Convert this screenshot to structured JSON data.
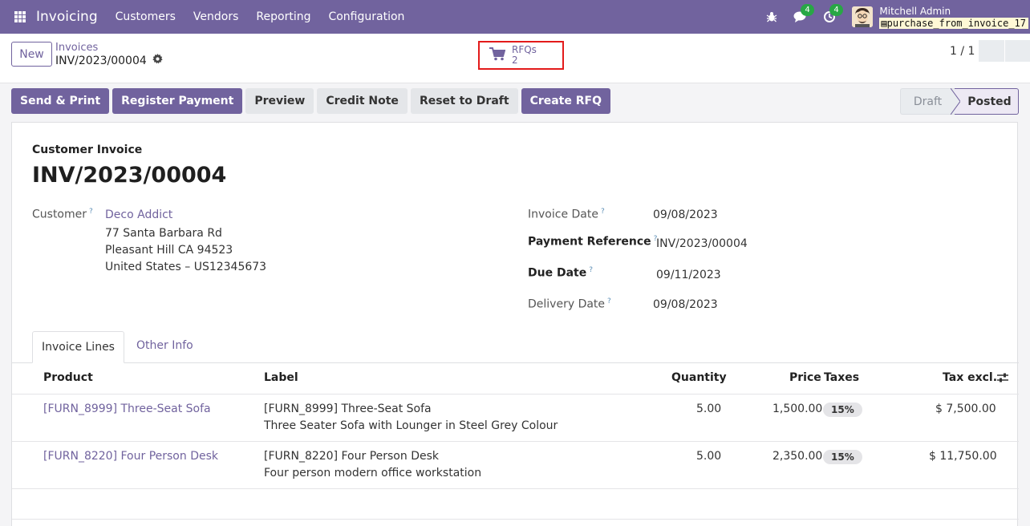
{
  "navbar": {
    "app_name": "Invoicing",
    "menu": [
      "Customers",
      "Vendors",
      "Reporting",
      "Configuration"
    ],
    "messages_count": "4",
    "activities_count": "4",
    "user_name": "Mitchell Admin",
    "db_name": "purchase_from_invoice_17"
  },
  "control": {
    "new_label": "New",
    "breadcrumb_parent": "Invoices",
    "breadcrumb_current": "INV/2023/00004",
    "smart_button": {
      "label": "RFQs",
      "count": "2"
    },
    "pager": "1 / 1"
  },
  "actions": {
    "send_print": "Send & Print",
    "register_payment": "Register Payment",
    "preview": "Preview",
    "credit_note": "Credit Note",
    "reset_to_draft": "Reset to Draft",
    "create_rfq": "Create RFQ"
  },
  "status": {
    "draft": "Draft",
    "posted": "Posted"
  },
  "document": {
    "type": "Customer Invoice",
    "name": "INV/2023/00004",
    "customer_label": "Customer",
    "customer_name": "Deco Addict",
    "address_line1": "77 Santa Barbara Rd",
    "address_line2": "Pleasant Hill CA 94523",
    "address_line3": "United States – US12345673",
    "invoice_date_label": "Invoice Date",
    "invoice_date": "09/08/2023",
    "payment_ref_label": "Payment Reference",
    "payment_ref": "INV/2023/00004",
    "due_date_label": "Due Date",
    "due_date": "09/11/2023",
    "delivery_date_label": "Delivery Date",
    "delivery_date": "09/08/2023",
    "help_mark": "?"
  },
  "tabs": [
    "Invoice Lines",
    "Other Info"
  ],
  "table": {
    "headers": {
      "product": "Product",
      "label": "Label",
      "quantity": "Quantity",
      "price": "Price",
      "taxes": "Taxes",
      "tax_excl": "Tax excl."
    },
    "rows": [
      {
        "product": "[FURN_8999] Three-Seat Sofa",
        "label1": "[FURN_8999] Three-Seat Sofa",
        "label2": "Three Seater Sofa with Lounger in Steel Grey Colour",
        "quantity": "5.00",
        "price": "1,500.00",
        "tax": "15%",
        "subtotal": "$ 7,500.00"
      },
      {
        "product": "[FURN_8220] Four Person Desk",
        "label1": "[FURN_8220] Four Person Desk",
        "label2": "Four person modern office workstation",
        "quantity": "5.00",
        "price": "2,350.00",
        "tax": "15%",
        "subtotal": "$ 11,750.00"
      }
    ]
  }
}
